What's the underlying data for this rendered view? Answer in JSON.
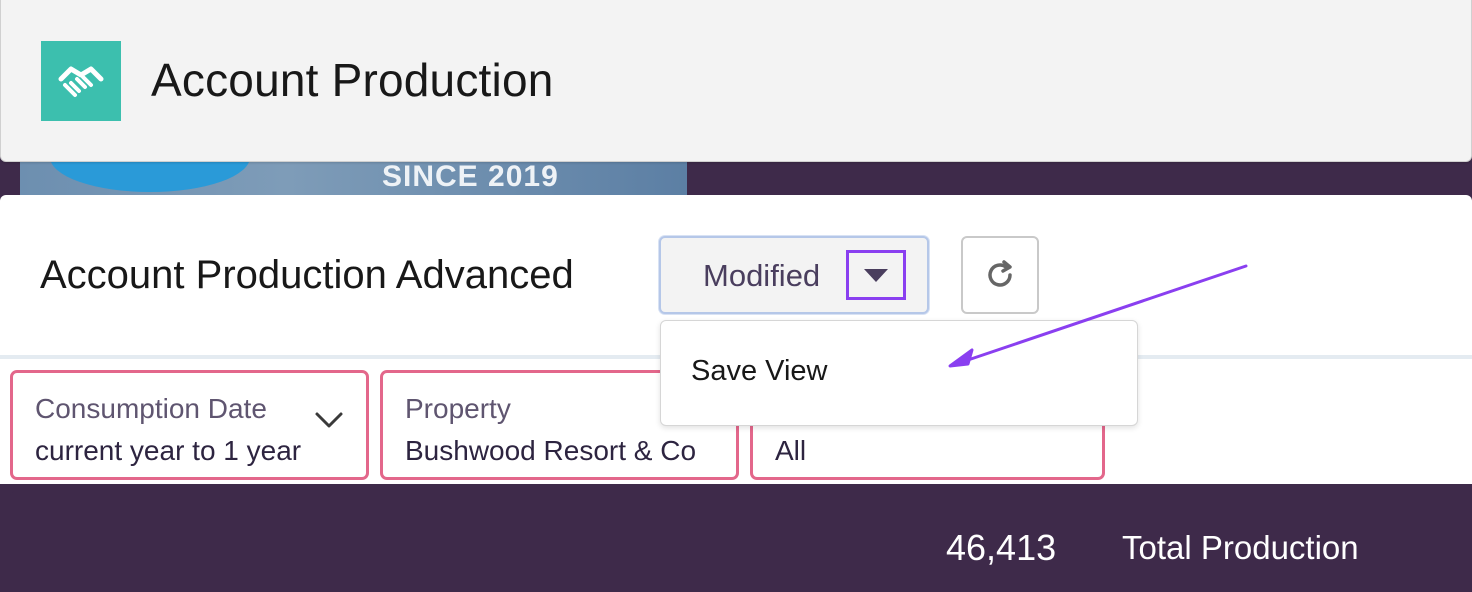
{
  "app": {
    "title": "Account Production",
    "icon": "handshake-icon",
    "icon_color": "#3cbfae"
  },
  "banner": {
    "text": "SINCE 2019"
  },
  "view": {
    "title": "Account Production Advanced",
    "status_label": "Modified",
    "toggle_icon": "caret-down-icon",
    "refresh_icon": "refresh-icon"
  },
  "dropdown": {
    "items": [
      {
        "label": "Save View"
      }
    ]
  },
  "filters": [
    {
      "label": "Consumption Date",
      "value": "current year to 1 year"
    },
    {
      "label": "Property",
      "value": "Bushwood Resort & Co"
    },
    {
      "label": "",
      "value": "All"
    }
  ],
  "production": {
    "value": "46,413",
    "label": "Total Production"
  },
  "colors": {
    "accent": "#8a3ff0",
    "filter_border": "#e3678b",
    "dark_purple": "#3e2a4a"
  }
}
